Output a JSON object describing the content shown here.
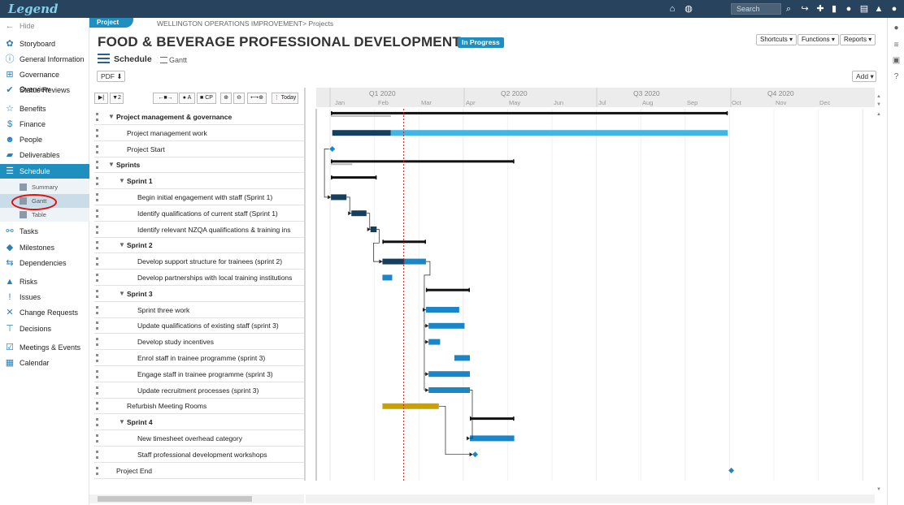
{
  "app": {
    "logo": "Legend"
  },
  "topbar": {
    "search_placeholder": "Search"
  },
  "sidebar": {
    "hide_label": "Hide",
    "items": [
      {
        "label": "Storyboard"
      },
      {
        "label": "General Information"
      },
      {
        "label": "Governance Overview"
      },
      {
        "label": "Status Reviews"
      },
      {
        "label": "Benefits"
      },
      {
        "label": "Finance"
      },
      {
        "label": "People"
      },
      {
        "label": "Deliverables"
      },
      {
        "label": "Schedule"
      },
      {
        "label": "Tasks"
      },
      {
        "label": "Milestones"
      },
      {
        "label": "Dependencies"
      },
      {
        "label": "Risks"
      },
      {
        "label": "Issues"
      },
      {
        "label": "Change Requests"
      },
      {
        "label": "Decisions"
      },
      {
        "label": "Meetings & Events"
      },
      {
        "label": "Calendar"
      }
    ],
    "schedule_sub": [
      {
        "label": "Summary"
      },
      {
        "label": "Gantt"
      },
      {
        "label": "Table"
      }
    ]
  },
  "header": {
    "badge": "Project",
    "breadcrumb": "WELLINGTON OPERATIONS IMPROVEMENT> Projects",
    "title": "FOOD & BEVERAGE PROFESSIONAL DEVELOPMENT",
    "status": "In Progress",
    "section": "Schedule",
    "view": "Gantt",
    "shortcuts": "Shortcuts",
    "functions": "Functions",
    "reports": "Reports",
    "pdf": "PDF",
    "add": "Add"
  },
  "toolbar": {
    "filter_count": "2",
    "today": "Today",
    "cp": "CP",
    "all": "A"
  },
  "timeline": {
    "quarters": [
      "Q1 2020",
      "Q2 2020",
      "Q3 2020",
      "Q4 2020"
    ],
    "months": [
      "Jan",
      "Feb",
      "Mar",
      "Apr",
      "May",
      "Jun",
      "Jul",
      "Aug",
      "Sep",
      "Oct",
      "Nov",
      "Dec"
    ]
  },
  "colors": {
    "accent": "#1f8fc0",
    "bar": "#1a86c7",
    "bar_complete": "#153f5e",
    "task_light": "#41b6e6",
    "highlight_bar": "#c9a100",
    "today_line": "#d11"
  },
  "rows": [
    {
      "name": "Project management & governance",
      "level": 0,
      "group": true
    },
    {
      "name": "Project management work",
      "level": 1,
      "group": false
    },
    {
      "name": "Project Start",
      "level": 1,
      "group": false
    },
    {
      "name": "Sprints",
      "level": 0,
      "group": true
    },
    {
      "name": "Sprint 1",
      "level": 1,
      "group": true
    },
    {
      "name": "Begin initial engagement with staff (Sprint 1)",
      "level": 2,
      "group": false
    },
    {
      "name": "Identify qualifications of current staff (Sprint 1)",
      "level": 2,
      "group": false
    },
    {
      "name": "Identify relevant NZQA qualifications & training ins",
      "level": 2,
      "group": false
    },
    {
      "name": "Sprint 2",
      "level": 1,
      "group": true
    },
    {
      "name": "Develop support structure for trainees (sprint 2)",
      "level": 2,
      "group": false
    },
    {
      "name": "Develop partnerships with local training institutions",
      "level": 2,
      "group": false
    },
    {
      "name": "Sprint 3",
      "level": 1,
      "group": true
    },
    {
      "name": "Sprint three work",
      "level": 2,
      "group": false
    },
    {
      "name": "Update qualifications of existing staff (sprint 3)",
      "level": 2,
      "group": false
    },
    {
      "name": "Develop study incentives",
      "level": 2,
      "group": false
    },
    {
      "name": "Enrol staff in trainee programme (sprint 3)",
      "level": 2,
      "group": false
    },
    {
      "name": "Engage staff in trainee programme (sprint 3)",
      "level": 2,
      "group": false
    },
    {
      "name": "Update recruitment processes (sprint 3)",
      "level": 2,
      "group": false
    },
    {
      "name": "Refurbish Meeting Rooms",
      "level": 1,
      "group": false
    },
    {
      "name": "Sprint 4",
      "level": 1,
      "group": true
    },
    {
      "name": "New timesheet overhead category",
      "level": 2,
      "group": false
    },
    {
      "name": "Staff professional development workshops",
      "level": 2,
      "group": false
    },
    {
      "name": "Project End",
      "level": 0,
      "group": false
    }
  ]
}
